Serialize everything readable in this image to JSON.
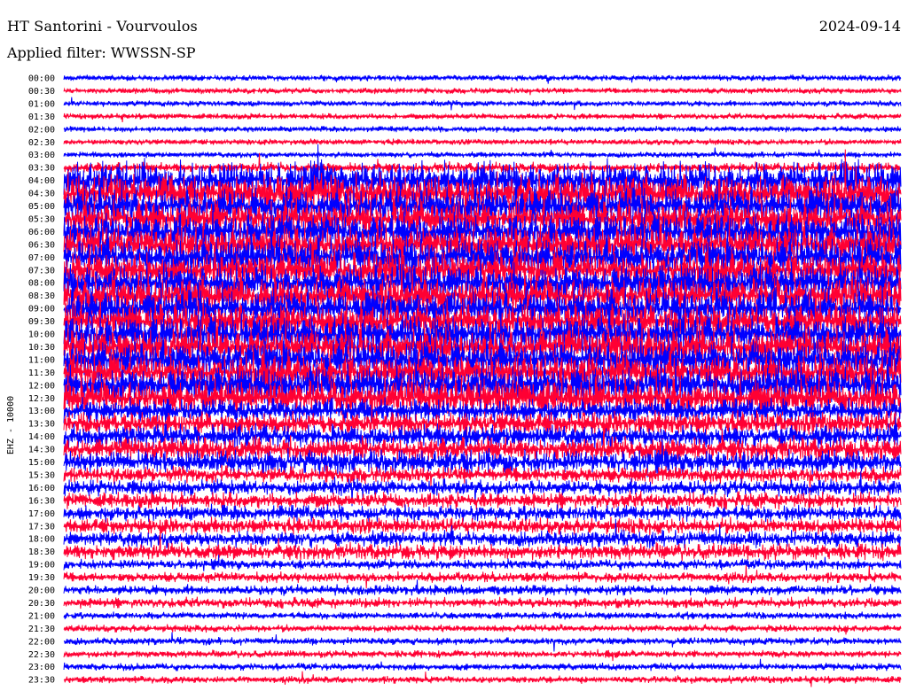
{
  "header": {
    "station": "HT Santorini - Vourvoulos",
    "date": "2024-09-14",
    "filter": "Applied filter: WWSSN-SP"
  },
  "chart_data": {
    "type": "line",
    "ylabel": "EHZ - 10000",
    "xlabel": "",
    "title": "HT Santorini - Vourvoulos",
    "series_colors": [
      "#0000ff",
      "#ff0033"
    ],
    "row_labels": [
      "00:00",
      "00:30",
      "01:00",
      "01:30",
      "02:00",
      "02:30",
      "03:00",
      "03:30",
      "04:00",
      "04:30",
      "05:00",
      "05:30",
      "06:00",
      "06:30",
      "07:00",
      "07:30",
      "08:00",
      "08:30",
      "09:00",
      "09:30",
      "10:00",
      "10:30",
      "11:00",
      "11:30",
      "12:00",
      "12:30",
      "13:00",
      "13:30",
      "14:00",
      "14:30",
      "15:00",
      "15:30",
      "16:00",
      "16:30",
      "17:00",
      "17:30",
      "18:00",
      "18:30",
      "19:00",
      "19:30",
      "20:00",
      "20:30",
      "21:00",
      "21:30",
      "22:00",
      "22:30",
      "23:00",
      "23:30"
    ],
    "grid": false,
    "legend": "none"
  }
}
